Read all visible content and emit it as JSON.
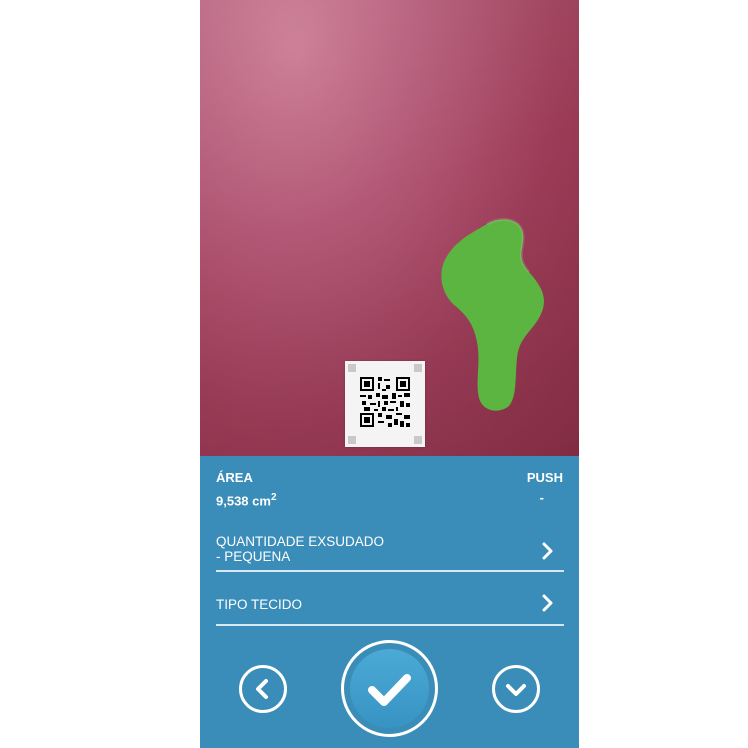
{
  "measurement": {
    "area_label": "ÁREA",
    "area_value": "9,538 cm",
    "area_unit_superscript": "2",
    "push_label": "PUSH",
    "push_value": "-"
  },
  "fields": [
    {
      "label": "QUANTIDADE EXSUDADO",
      "value": "- PEQUENA"
    },
    {
      "label": "TIPO TECIDO",
      "value": ""
    }
  ],
  "colors": {
    "panel": "#3a8db8",
    "wound_overlay": "#5bb540",
    "confirm_button": "#3f9fcf"
  },
  "icons": {
    "back": "chevron-left-icon",
    "confirm": "check-icon",
    "more": "chevron-down-icon",
    "row": "chevron-right-icon"
  }
}
